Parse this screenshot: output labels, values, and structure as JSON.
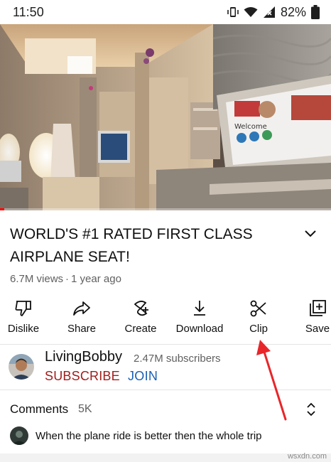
{
  "status_bar": {
    "time": "11:50",
    "battery": "82%",
    "icons": [
      "vibrate-icon",
      "wifi-icon",
      "signal-icon",
      "battery-icon"
    ]
  },
  "video": {
    "screen_text": "Welcome",
    "progress_fraction": 0.012,
    "progress_color": "#ff0000"
  },
  "video_info": {
    "title": "WORLD'S #1 RATED FIRST CLASS AIRPLANE SEAT!",
    "views": "6.7M views",
    "separator": "·",
    "age": "1 year ago"
  },
  "actions": [
    {
      "label": "Dislike",
      "icon": "thumbs-down-icon"
    },
    {
      "label": "Share",
      "icon": "share-arrow-icon"
    },
    {
      "label": "Create",
      "icon": "create-icon"
    },
    {
      "label": "Download",
      "icon": "download-icon"
    },
    {
      "label": "Clip",
      "icon": "scissors-icon"
    },
    {
      "label": "Save",
      "icon": "add-to-playlist-icon"
    }
  ],
  "channel": {
    "name": "LivingBobby",
    "subscribers": "2.47M subscribers",
    "subscribe_label": "SUBSCRIBE",
    "join_label": "JOIN"
  },
  "comments": {
    "label": "Comments",
    "count": "5K",
    "top_comment": "When the plane ride is better then the whole trip"
  },
  "watermark": "wsxdn.com",
  "colors": {
    "subscribe": "#a11d1d",
    "join": "#1a5fb4",
    "annotation_arrow": "#e8262a"
  }
}
